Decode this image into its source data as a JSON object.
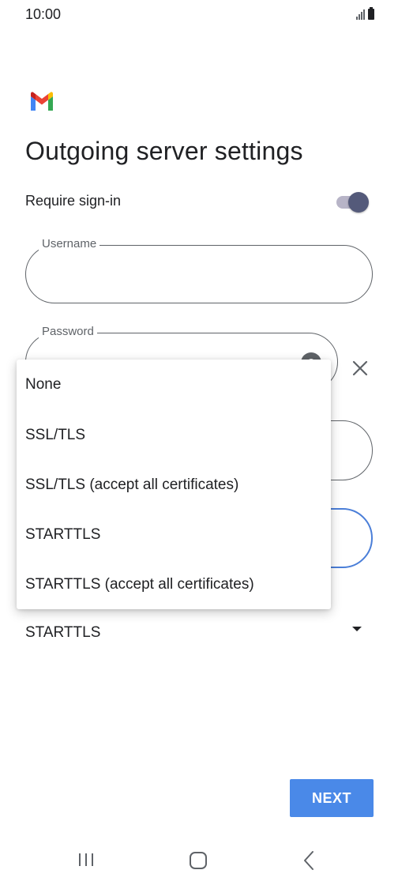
{
  "status_bar": {
    "time": "10:00",
    "icons": [
      "signal-icon",
      "battery-icon"
    ]
  },
  "app": {
    "logo": "gmail-logo"
  },
  "page": {
    "title": "Outgoing server settings"
  },
  "require_signin": {
    "label": "Require sign-in",
    "enabled": true
  },
  "username": {
    "label": "Username",
    "value": ""
  },
  "password": {
    "label": "Password",
    "value": "",
    "icons": [
      "eye-icon",
      "clear-icon"
    ]
  },
  "security_type": {
    "selected": "STARTTLS",
    "options": [
      "None",
      "SSL/TLS",
      "SSL/TLS (accept all certificates)",
      "STARTTLS",
      "STARTTLS (accept all certificates)"
    ]
  },
  "actions": {
    "next_label": "NEXT"
  },
  "nav": {
    "icons": [
      "recents-icon",
      "home-icon",
      "back-icon"
    ]
  },
  "colors": {
    "accent_blue": "#4a89e8",
    "toggle_thumb": "#545a7a",
    "toggle_track": "#b7b4c7",
    "focus_outline": "#4a7ed8"
  }
}
